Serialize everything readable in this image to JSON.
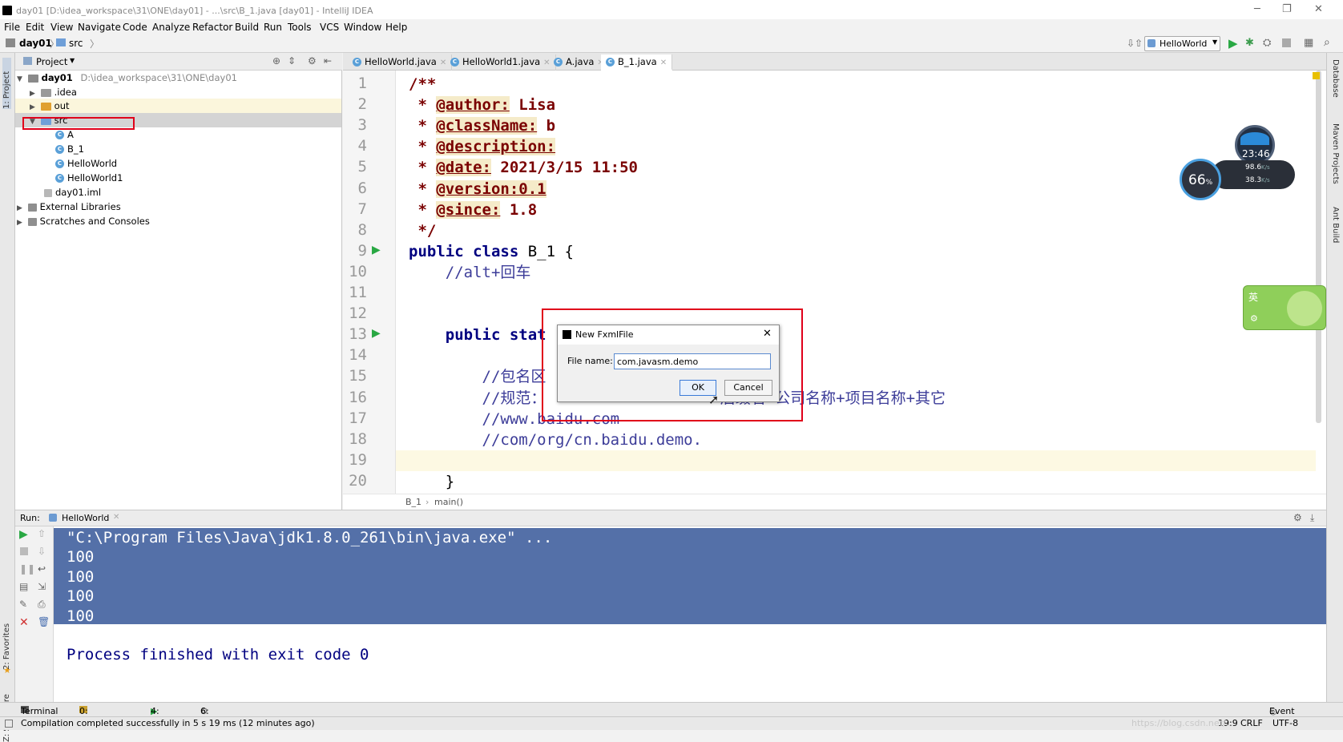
{
  "window": {
    "title": "day01 [D:\\idea_workspace\\31\\ONE\\day01] - ...\\src\\B_1.java [day01] - IntelliJ IDEA",
    "minimize": "─",
    "maximize": "❐",
    "close": "✕"
  },
  "menu": [
    "File",
    "Edit",
    "View",
    "Navigate",
    "Code",
    "Analyze",
    "Refactor",
    "Build",
    "Run",
    "Tools",
    "VCS",
    "Window",
    "Help"
  ],
  "navbar": {
    "crumbs": [
      "day01",
      "src"
    ],
    "run_config": "HelloWorld"
  },
  "project": {
    "header": "Project",
    "tree": [
      {
        "label": "day01",
        "path": "D:\\idea_workspace\\31\\ONE\\day01",
        "type": "module",
        "expanded": true
      },
      {
        "label": ".idea",
        "type": "folder"
      },
      {
        "label": "out",
        "type": "folder-orange"
      },
      {
        "label": "src",
        "type": "folder-src",
        "expanded": true,
        "selected": true
      },
      {
        "label": "A",
        "type": "class"
      },
      {
        "label": "B_1",
        "type": "class"
      },
      {
        "label": "HelloWorld",
        "type": "class"
      },
      {
        "label": "HelloWorld1",
        "type": "class"
      },
      {
        "label": "day01.iml",
        "type": "file"
      },
      {
        "label": "External Libraries",
        "type": "lib"
      },
      {
        "label": "Scratches and Consoles",
        "type": "scratch"
      }
    ]
  },
  "left_strip": {
    "project": "1: Project",
    "favorites": "2: Favorites",
    "structure": "Z: Structure"
  },
  "right_strip": {
    "database": "Database",
    "maven": "Maven Projects",
    "ant": "Ant Build"
  },
  "tabs": [
    "HelloWorld.java",
    "HelloWorld1.java",
    "A.java",
    "B_1.java"
  ],
  "active_tab": "B_1.java",
  "code": {
    "lines": [
      {
        "n": "1",
        "parts": [
          {
            "c": "cm",
            "t": "/**"
          }
        ]
      },
      {
        "n": "2",
        "parts": [
          {
            "c": "cm",
            "t": " * "
          },
          {
            "c": "tag",
            "t": "@author:"
          },
          {
            "c": "cm",
            "t": " Lisa"
          }
        ]
      },
      {
        "n": "3",
        "parts": [
          {
            "c": "cm",
            "t": " * "
          },
          {
            "c": "tag",
            "t": "@className:"
          },
          {
            "c": "cm",
            "t": " b"
          }
        ]
      },
      {
        "n": "4",
        "parts": [
          {
            "c": "cm",
            "t": " * "
          },
          {
            "c": "tag",
            "t": "@description:"
          }
        ]
      },
      {
        "n": "5",
        "parts": [
          {
            "c": "cm",
            "t": " * "
          },
          {
            "c": "tag",
            "t": "@date:"
          },
          {
            "c": "cm",
            "t": " 2021/3/15 11:50"
          }
        ]
      },
      {
        "n": "6",
        "parts": [
          {
            "c": "cm",
            "t": " * "
          },
          {
            "c": "tag",
            "t": "@version:0.1"
          }
        ]
      },
      {
        "n": "7",
        "parts": [
          {
            "c": "cm",
            "t": " * "
          },
          {
            "c": "tag",
            "t": "@since:"
          },
          {
            "c": "cm",
            "t": " 1.8"
          }
        ]
      },
      {
        "n": "8",
        "parts": [
          {
            "c": "cm",
            "t": " */"
          }
        ]
      },
      {
        "n": "9",
        "parts": [
          {
            "c": "kw",
            "t": "public class"
          },
          {
            "c": "",
            "t": " B_1 {"
          }
        ]
      },
      {
        "n": "10",
        "parts": [
          {
            "c": "lc",
            "t": "    //alt+回车"
          }
        ]
      },
      {
        "n": "11",
        "parts": []
      },
      {
        "n": "12",
        "parts": []
      },
      {
        "n": "13",
        "parts": [
          {
            "c": "kw",
            "t": "    public stat"
          },
          {
            "c": "",
            "t": "                 rgs) {"
          }
        ]
      },
      {
        "n": "14",
        "parts": []
      },
      {
        "n": "15",
        "parts": [
          {
            "c": "lc",
            "t": "        //包名区"
          }
        ]
      },
      {
        "n": "16",
        "parts": [
          {
            "c": "lc",
            "t": "        //规范：                   后缀名+公司名称+项目名称+其它"
          }
        ]
      },
      {
        "n": "17",
        "parts": [
          {
            "c": "lc",
            "t": "        //www.baidu.com"
          }
        ]
      },
      {
        "n": "18",
        "parts": [
          {
            "c": "lc",
            "t": "        //com/org/cn.baidu.demo."
          }
        ]
      },
      {
        "n": "19",
        "parts": []
      },
      {
        "n": "20",
        "parts": [
          {
            "c": "",
            "t": "    }"
          }
        ]
      }
    ]
  },
  "editor_breadcrumb": [
    "B_1",
    "main()"
  ],
  "run": {
    "label": "Run:",
    "tab": "HelloWorld",
    "console": [
      "\"C:\\Program Files\\Java\\jdk1.8.0_261\\bin\\java.exe\" ...",
      "100",
      "100",
      "100",
      "100",
      "",
      "Process finished with exit code 0"
    ]
  },
  "bottom_tabs": [
    "Terminal",
    "0: Messages",
    "4: Run",
    "6: TODO"
  ],
  "event_log": "Event Log",
  "status": {
    "message": "Compilation completed successfully in 5 s 19 ms (12 minutes ago)",
    "position": "19:9",
    "line_sep": "CRLF",
    "encoding": "UTF-8"
  },
  "dialog": {
    "title": "New FxmlFile",
    "label": "File name:",
    "value": "com.javasm.demo",
    "ok": "OK",
    "cancel": "Cancel",
    "close": "✕"
  },
  "widget": {
    "clock": "23:46",
    "percent": "66",
    "percent_sign": "%",
    "up": "98.6",
    "down": "38.3",
    "rate_unit": "K/s"
  },
  "ime": {
    "lang": "英"
  },
  "watermark": "https://blog.csdn.net/..."
}
